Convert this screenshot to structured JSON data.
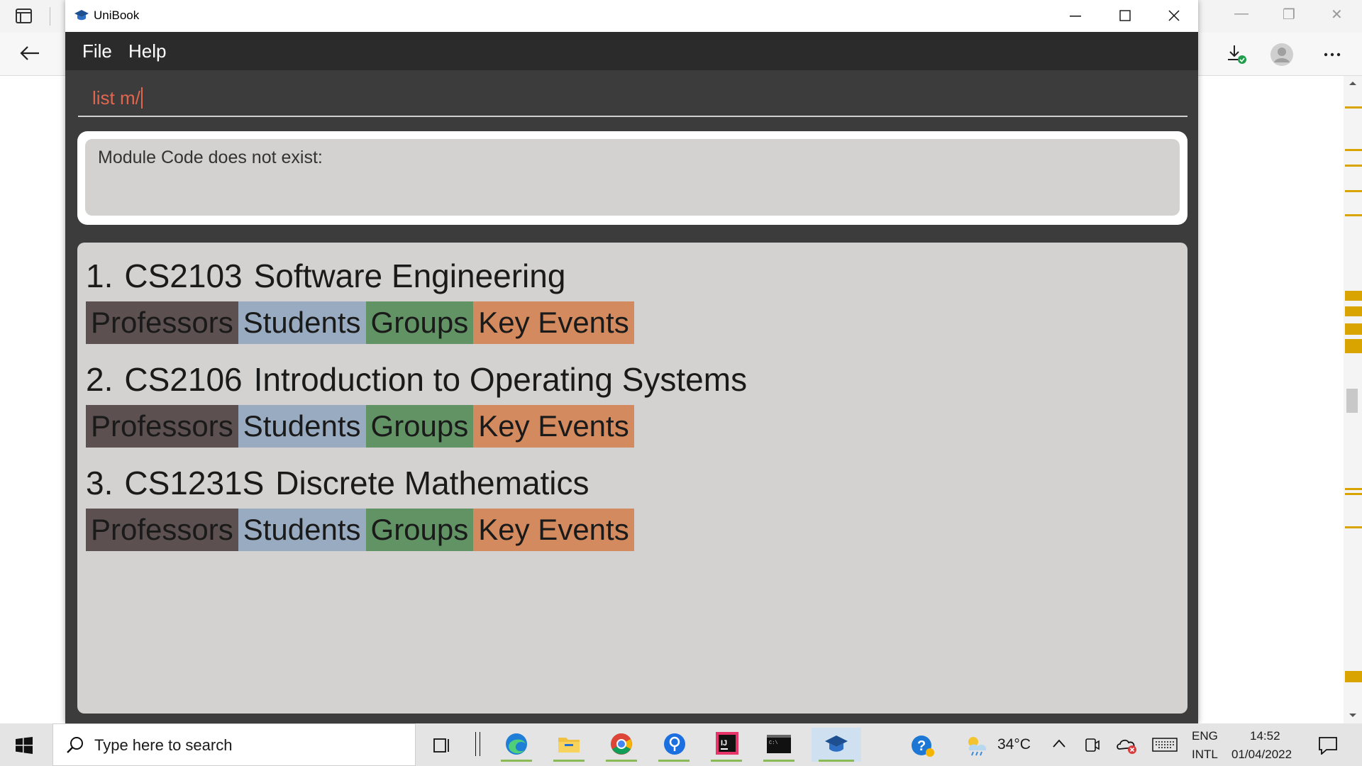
{
  "app": {
    "title": "UniBook",
    "menu": [
      "File",
      "Help"
    ]
  },
  "command": {
    "value": "list m/"
  },
  "result": {
    "message": "Module Code does not exist:"
  },
  "modules": [
    {
      "index": "1.",
      "code": "CS2103",
      "name": "Software Engineering"
    },
    {
      "index": "2.",
      "code": "CS2106",
      "name": "Introduction to Operating Systems"
    },
    {
      "index": "3.",
      "code": "CS1231S",
      "name": "Discrete Mathematics"
    }
  ],
  "tags": {
    "professors": "Professors",
    "students": "Students",
    "groups": "Groups",
    "events": "Key Events"
  },
  "taskbar": {
    "search_placeholder": "Type here to search",
    "temperature": "34°C",
    "lang_top": "ENG",
    "lang_bottom": "INTL",
    "time": "14:52",
    "date": "01/04/2022"
  },
  "colors": {
    "tag_professors": "#5c5050",
    "tag_students": "#98abc0",
    "tag_groups": "#629364",
    "tag_events": "#d28a5e",
    "command_text": "#e2664f"
  }
}
